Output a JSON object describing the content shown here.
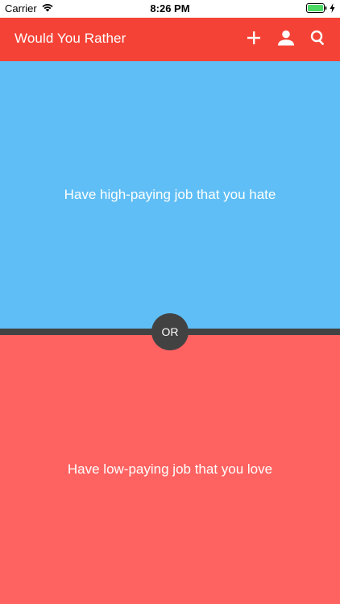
{
  "status_bar": {
    "carrier": "Carrier",
    "time": "8:26 PM"
  },
  "app_bar": {
    "title": "Would You Rather",
    "actions": [
      "add-icon",
      "person-icon",
      "search-icon"
    ],
    "color": "#f44336"
  },
  "question": {
    "option_a": {
      "text": "Have high-paying job that you hate",
      "color": "#5fbef5"
    },
    "separator": "OR",
    "option_b": {
      "text": "Have low-paying job that you love",
      "color": "#ff6361"
    }
  }
}
